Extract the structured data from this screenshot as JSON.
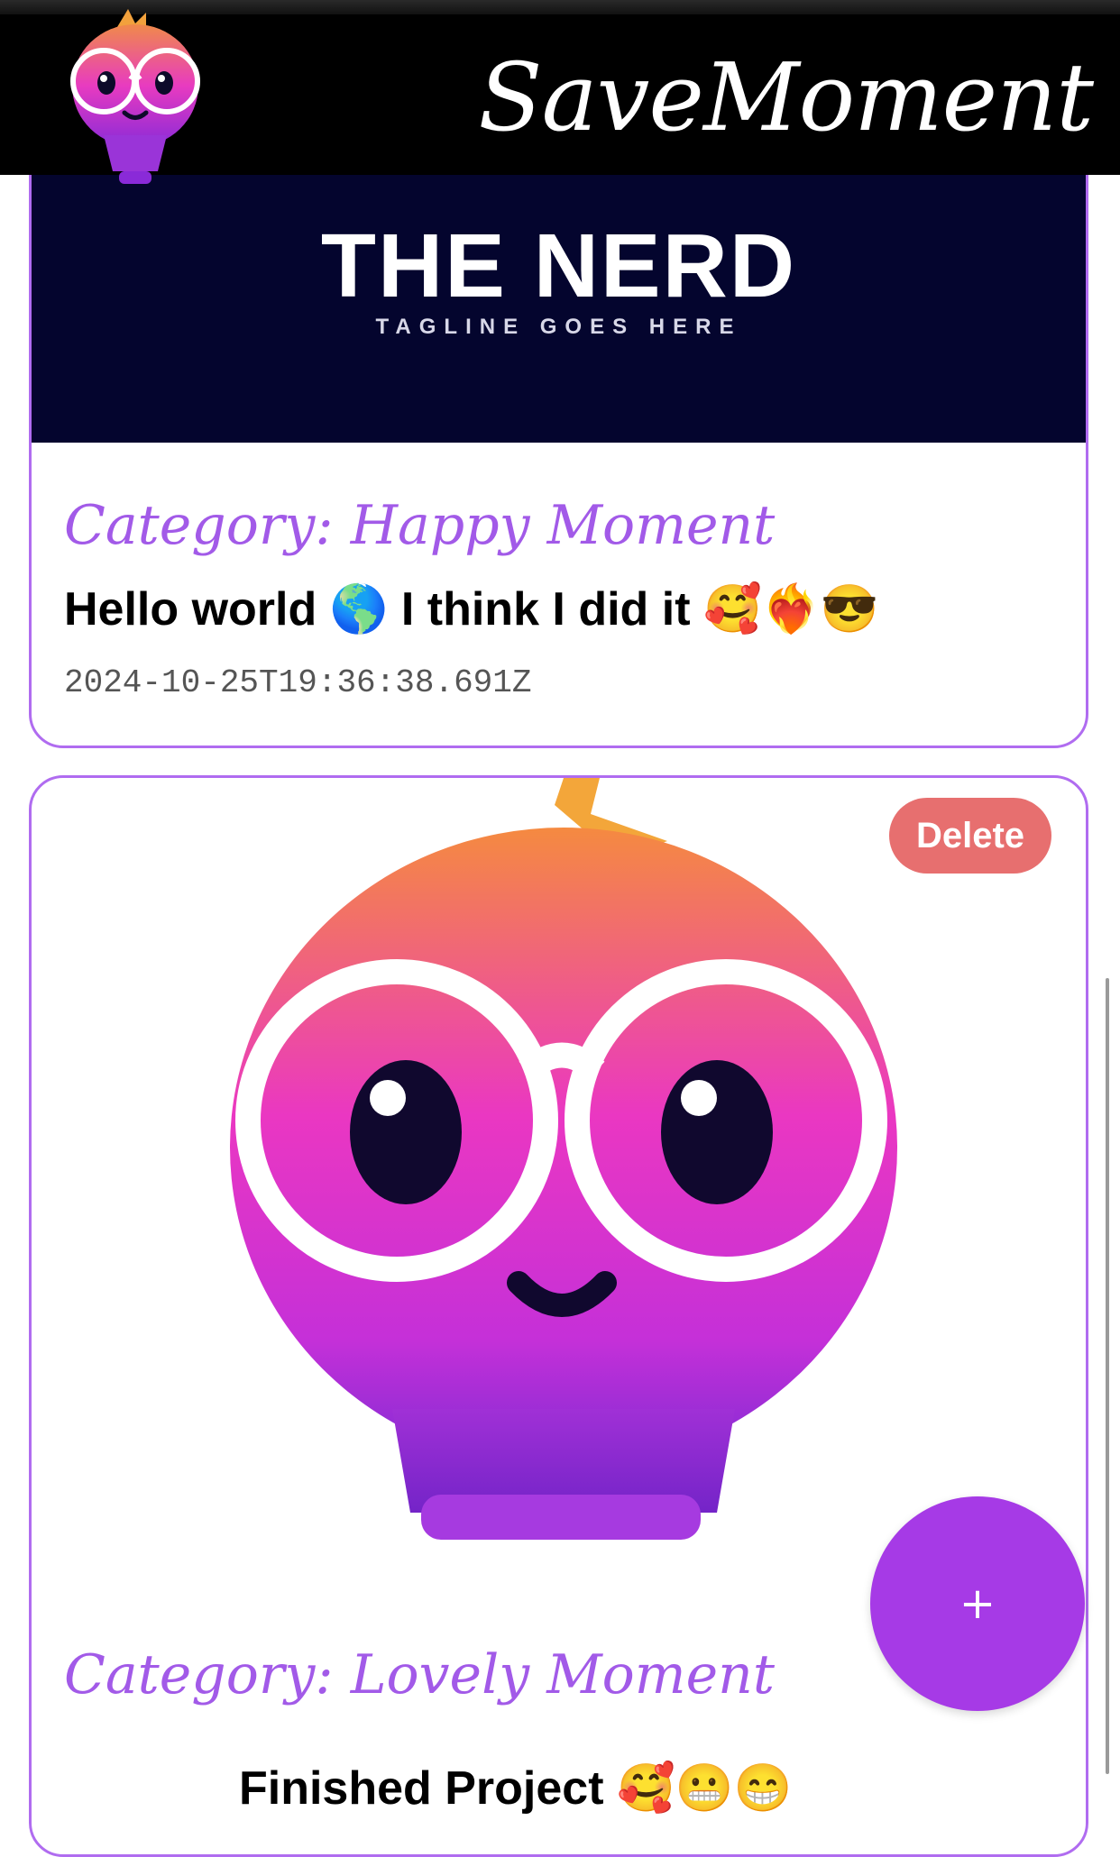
{
  "app": {
    "title": "SaveMoment"
  },
  "moments": [
    {
      "banner_title": "THE NERD",
      "banner_tagline": "TAGLINE GOES HERE",
      "category": "Category: Happy Moment",
      "message": "Hello world 🌎 I think I did it 🥰❤️‍🔥😎",
      "timestamp": "2024-10-25T19:36:38.691Z"
    },
    {
      "delete_label": "Delete",
      "category": "Category: Lovely Moment",
      "message": "Finished Project 🥰😬😁"
    }
  ],
  "fab": {
    "label": "+"
  },
  "colors": {
    "accent": "#a63ae6",
    "border": "#b06cf0",
    "category": "#a25ae8",
    "delete": "#e76f6f",
    "banner": "#04052e"
  }
}
